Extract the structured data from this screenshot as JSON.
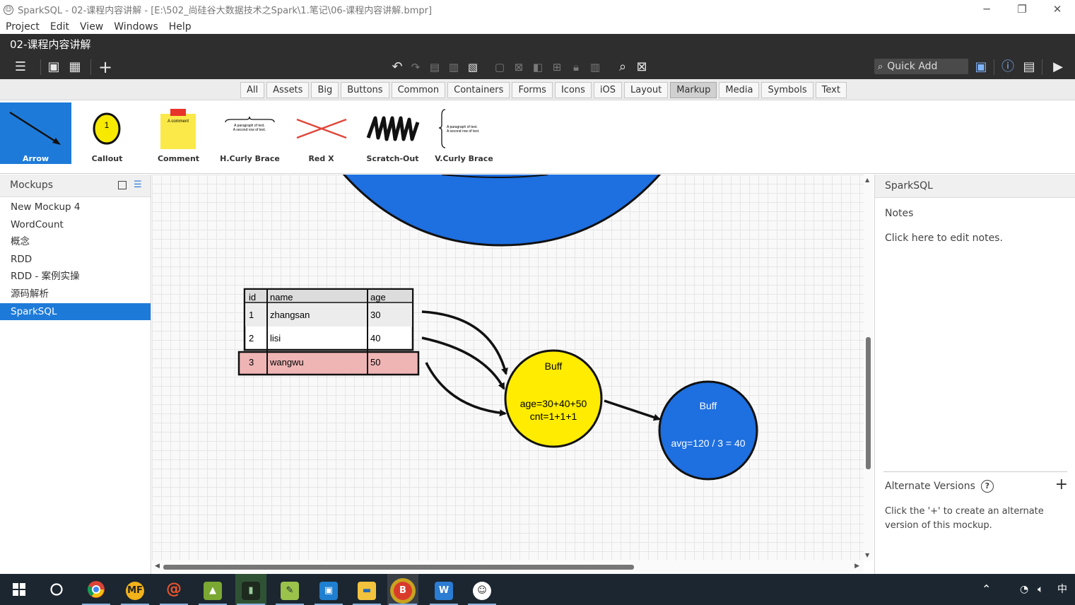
{
  "window": {
    "title": "SparkSQL - 02-课程内容讲解 - [E:\\502_尚硅谷大数据技术之Spark\\1.笔记\\06-课程内容讲解.bmpr]",
    "controls": [
      "─",
      "❐",
      "✕"
    ]
  },
  "menu": [
    "Project",
    "Edit",
    "View",
    "Windows",
    "Help"
  ],
  "document": {
    "title": "02-课程内容讲解"
  },
  "toolbar": {
    "quick_add_placeholder": "Quick Add"
  },
  "filters": {
    "tabs": [
      "All",
      "Assets",
      "Big",
      "Buttons",
      "Common",
      "Containers",
      "Forms",
      "Icons",
      "iOS",
      "Layout",
      "Markup",
      "Media",
      "Symbols",
      "Text"
    ],
    "active": "Markup"
  },
  "library": {
    "items": [
      "Arrow",
      "Callout",
      "Comment",
      "H.Curly Brace",
      "Red X",
      "Scratch-Out",
      "V.Curly Brace"
    ],
    "selected": "Arrow",
    "callout_number": "1",
    "comment_text": "A comment",
    "brace_text": [
      "A paragraph of text.",
      "A second row of text."
    ]
  },
  "mockups": {
    "title": "Mockups",
    "items": [
      "New Mockup 4",
      "WordCount",
      "概念",
      "RDD",
      "RDD - 案例实操",
      "源码解析",
      "SparkSQL"
    ],
    "selected": "SparkSQL"
  },
  "canvas": {
    "table": {
      "headers": [
        "id",
        "name",
        "age"
      ],
      "rows": [
        [
          "1",
          "zhangsan",
          "30"
        ],
        [
          "2",
          "lisi",
          "40"
        ],
        [
          "3",
          "wangwu",
          "50"
        ]
      ]
    },
    "buff1": {
      "title": "Buff",
      "line1": "age=30+40+50",
      "line2": "cnt=1+1+1",
      "color": "#ffec00"
    },
    "buff2": {
      "title": "Buff",
      "line1": "avg=120 / 3 = 40",
      "color": "#1e6fe0"
    },
    "circle_color": "#1e6fe0",
    "highlight_color": "#efb5b5"
  },
  "properties": {
    "title": "SparkSQL",
    "notes_label": "Notes",
    "notes_text": "Click here to edit notes.",
    "alt_versions_label": "Alternate Versions",
    "alt_versions_desc": "Click the '+' to create an alternate version of this mockup.",
    "help_glyph": "?",
    "plus_glyph": "+"
  },
  "taskbar": {
    "apps": [
      "windows-start",
      "search",
      "chrome",
      "mf",
      "scratch",
      "app-green",
      "app-dark",
      "notepad",
      "vm",
      "file-explorer",
      "balsamiq",
      "word",
      "smile"
    ],
    "tray_ime": "中"
  },
  "colors": {
    "accent": "#1e7ad9",
    "toolbar_bg": "#2e2e2e",
    "taskbar_bg": "#1b2630"
  }
}
